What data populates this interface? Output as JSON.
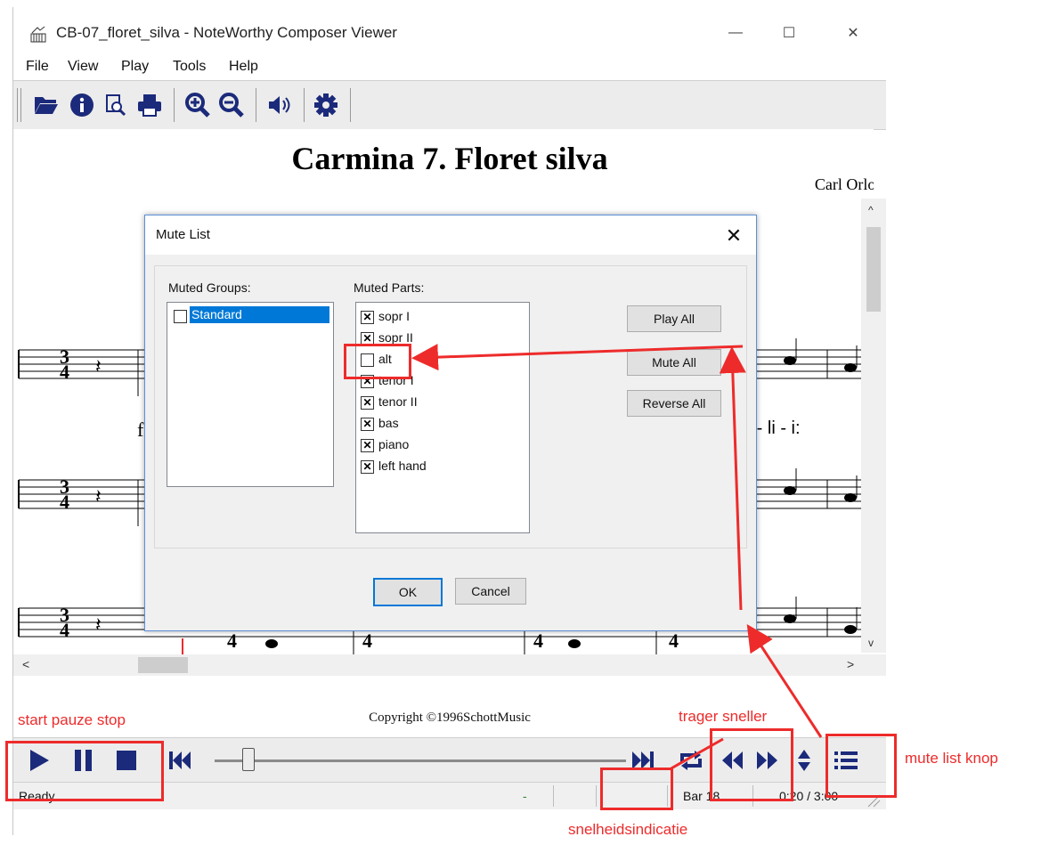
{
  "window": {
    "title": "CB-07_floret_silva - NoteWorthy Composer Viewer",
    "minimize": "—",
    "maximize": "☐",
    "close": "✕"
  },
  "menu": [
    "File",
    "View",
    "Play",
    "Tools",
    "Help"
  ],
  "toolbar_icons": [
    "open-icon",
    "info-icon",
    "print-preview-icon",
    "print-icon",
    "zoom-in-icon",
    "zoom-out-icon",
    "speaker-icon",
    "settings-icon"
  ],
  "score": {
    "title": "Carmina 7.  Floret silva",
    "composer": "Carl  Orloff",
    "time_signature_top": "3",
    "time_signature_bottom": "4",
    "lyrics_left": "f",
    "lyrics_right": "o - li  -  i:",
    "copyright": "Copyright ©1996SchottMusic"
  },
  "dialog": {
    "title": "Mute List",
    "close": "✕",
    "muted_groups_label": "Muted Groups:",
    "muted_parts_label": "Muted Parts:",
    "groups": [
      {
        "label": "Standard",
        "checked": false,
        "selected": true
      }
    ],
    "parts": [
      {
        "label": "sopr I",
        "checked": true
      },
      {
        "label": "sopr II",
        "checked": true
      },
      {
        "label": "alt",
        "checked": false
      },
      {
        "label": "tenor  I",
        "checked": true
      },
      {
        "label": "tenor II",
        "checked": true
      },
      {
        "label": "bas",
        "checked": true
      },
      {
        "label": "piano",
        "checked": true
      },
      {
        "label": "left hand",
        "checked": true
      }
    ],
    "buttons": {
      "play_all": "Play All",
      "mute_all": "Mute All",
      "reverse_all": "Reverse All",
      "ok": "OK",
      "cancel": "Cancel"
    }
  },
  "player": {
    "position_fraction": 0.08
  },
  "status": {
    "ready": "Ready",
    "dash": "-",
    "bar": "Bar 18",
    "time": "0:20 / 3:00"
  },
  "annotations": {
    "start_pause_stop": "start pauze stop",
    "slower_faster": "trager sneller",
    "mute_list_button": "mute list knop",
    "speed_indicator": "snelheidsindicatie"
  },
  "colors": {
    "annotation": "#ee2b2b",
    "icon": "#1b2a7a",
    "selection": "#0078d7"
  }
}
